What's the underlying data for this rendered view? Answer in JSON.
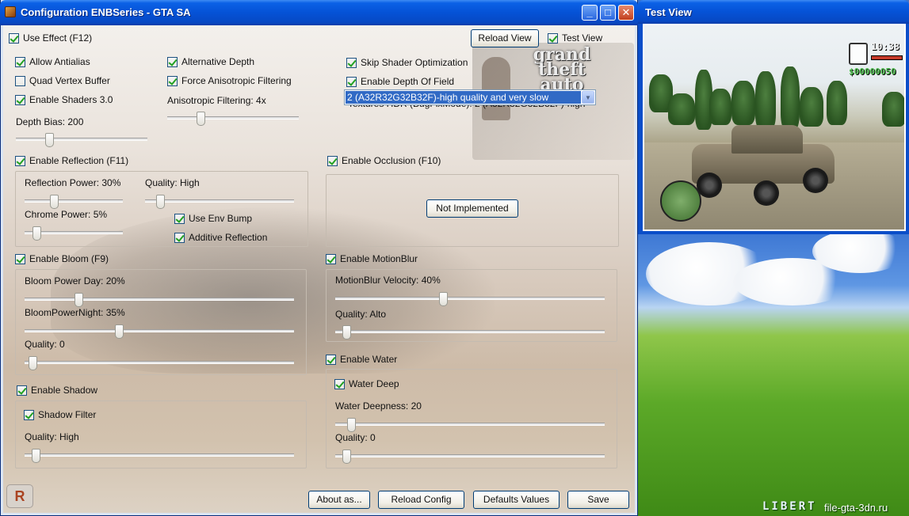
{
  "main_window": {
    "title": "Configuration ENBSeries - GTA SA",
    "minimize_glyph": "_",
    "maximize_glyph": "□",
    "close_glyph": "✕"
  },
  "top": {
    "use_effect": {
      "label": "Use Effect (F12)",
      "checked": true
    },
    "reload_view": "Reload View",
    "test_view": {
      "label": "Test View",
      "checked": true
    }
  },
  "general": {
    "allow_antialias": {
      "label": "Allow Antialias",
      "checked": true
    },
    "quad_vertex_buffer": {
      "label": "Quad Vertex Buffer",
      "checked": false
    },
    "enable_shaders": {
      "label": "Enable Shaders 3.0",
      "checked": true
    },
    "depth_bias": {
      "label": "Depth Bias: 200",
      "fraction": 0.25
    },
    "alternative_depth": {
      "label": "Alternative Depth",
      "checked": true
    },
    "force_aniso": {
      "label": "Force Anisotropic Filtering",
      "checked": true
    },
    "aniso_filtering": {
      "label": "Anisotropic Filtering: 4x",
      "fraction": 0.25
    },
    "skip_shader_opt": {
      "label": "Skip Shader Optimization",
      "checked": true
    },
    "enable_dof": {
      "label": "Enable Depth Of Field",
      "checked": true
    },
    "textures_hdr_label": "Textures HDR (BugFixMode): 2 (A32R32G32B32F)-high",
    "textures_hdr_value": "2 (A32R32G32B32F)-high quality and very slow",
    "dropdown_arrow": "▼"
  },
  "reflection": {
    "enable": {
      "label": "Enable Reflection (F11)",
      "checked": true
    },
    "power": {
      "label": "Reflection Power: 30%",
      "fraction": 0.3
    },
    "quality": {
      "label": "Quality: High",
      "fraction": 0.1
    },
    "chrome": {
      "label": "Chrome Power: 5%",
      "fraction": 0.12
    },
    "use_env_bump": {
      "label": "Use Env Bump",
      "checked": true
    },
    "additive": {
      "label": "Additive Reflection",
      "checked": true
    }
  },
  "occlusion": {
    "enable": {
      "label": "Enable Occlusion (F10)",
      "checked": true
    },
    "not_implemented": "Not Implemented"
  },
  "bloom": {
    "enable": {
      "label": "Enable Bloom (F9)",
      "checked": true
    },
    "day": {
      "label": "Bloom Power Day: 20%",
      "fraction": 0.2
    },
    "night": {
      "label": "BloomPowerNight: 35%",
      "fraction": 0.35
    },
    "quality": {
      "label": "Quality: 0",
      "fraction": 0.03
    }
  },
  "motionblur": {
    "enable": {
      "label": "Enable MotionBlur",
      "checked": true
    },
    "velocity": {
      "label": "MotionBlur Velocity: 40%",
      "fraction": 0.4
    },
    "quality": {
      "label": "Quality: Alto",
      "fraction": 0.04
    }
  },
  "shadow": {
    "enable": {
      "label": "Enable Shadow",
      "checked": true
    },
    "filter": {
      "label": "Shadow Filter",
      "checked": true
    },
    "quality": {
      "label": "Quality: High",
      "fraction": 0.04
    }
  },
  "water": {
    "enable": {
      "label": "Enable Water",
      "checked": true
    },
    "deep": {
      "label": "Water Deep",
      "checked": true
    },
    "deepness": {
      "label": "Water Deepness: 20",
      "fraction": 0.06
    },
    "quality": {
      "label": "Quality: 0",
      "fraction": 0.04
    }
  },
  "buttons": {
    "about": "About as...",
    "reload_config": "Reload Config",
    "defaults": "Defaults Values",
    "save": "Save"
  },
  "background": {
    "gta_logo": "grand theft auto",
    "rockstar": "R"
  },
  "test_window": {
    "title": "Test View",
    "hud_time": "10:38",
    "hud_money": "$00000050"
  },
  "desktop": {
    "logo": "LIBERT",
    "url": "file-gta-3dn.ru"
  }
}
